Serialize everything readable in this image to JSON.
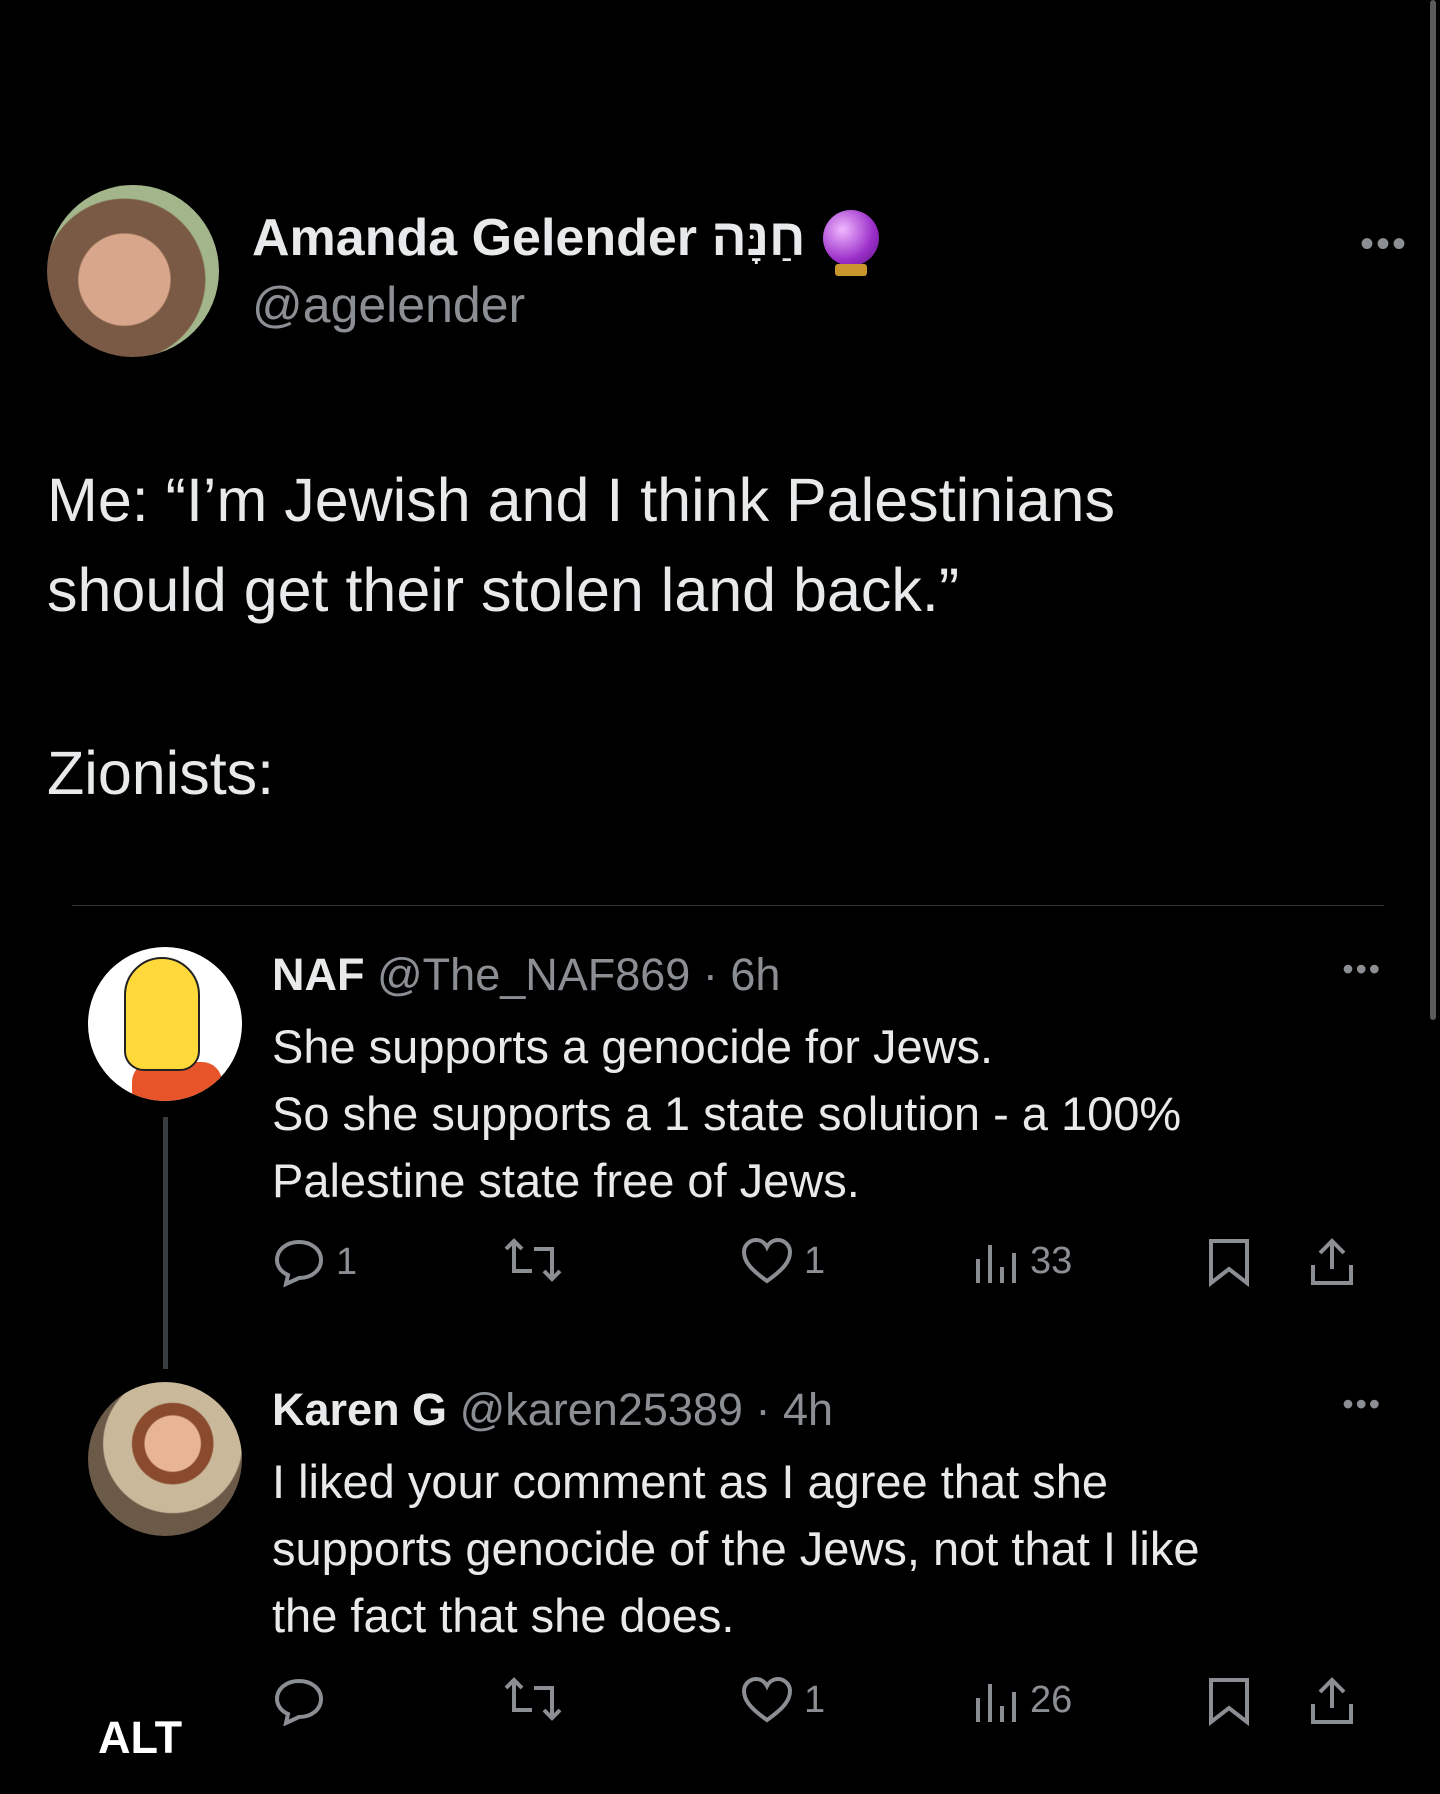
{
  "post": {
    "author_name": "Amanda Gelender חַנָּה",
    "author_handle": "@agelender",
    "more_icon": "more-horizontal-icon",
    "text_line1": "Me: “I’m Jewish and I think Palestinians",
    "text_line2": "should get their stolen land back.”",
    "text_line3": "Zionists:"
  },
  "replies": [
    {
      "name": "NAF",
      "meta": "@The_NAF869 · 6h",
      "lines": [
        "She supports a genocide for Jews.",
        "So she supports a 1 state solution - a 100%",
        "Palestine state free of Jews."
      ],
      "replies_count": "1",
      "likes_count": "1",
      "views_count": "33"
    },
    {
      "name": "Karen G",
      "meta": "@karen25389 · 4h",
      "lines": [
        "I liked your comment as I agree that she",
        "supports genocide of the Jews, not that I like",
        "the fact that she does."
      ],
      "replies_count": "",
      "likes_count": "1",
      "views_count": "26"
    }
  ],
  "alt_label": "ALT",
  "colors": {
    "background": "#000000",
    "text": "#e7e9ea",
    "muted": "#8b8f94",
    "divider": "#2f3336"
  }
}
